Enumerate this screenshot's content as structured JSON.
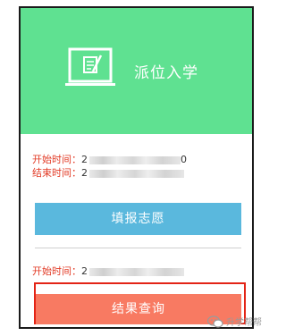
{
  "header": {
    "title": "派位入学",
    "icon": "laptop-edit-icon",
    "background_color": "#5fe191"
  },
  "schedule": {
    "start_label": "开始时间：",
    "start_value_visible": "2",
    "start_value_tail": "0",
    "end_label": "结束时间：",
    "end_value_visible": "2"
  },
  "actions": {
    "fill_button_label": "填报志愿",
    "fill_button_color": "#5ab8dd"
  },
  "result": {
    "start_label": "开始时间：",
    "start_value_visible": "2",
    "button_label": "结果查询",
    "button_color": "#f87a62",
    "highlight_color": "#e32416"
  },
  "watermark": {
    "text": "升学帮帮",
    "icon": "wechat-icon"
  }
}
